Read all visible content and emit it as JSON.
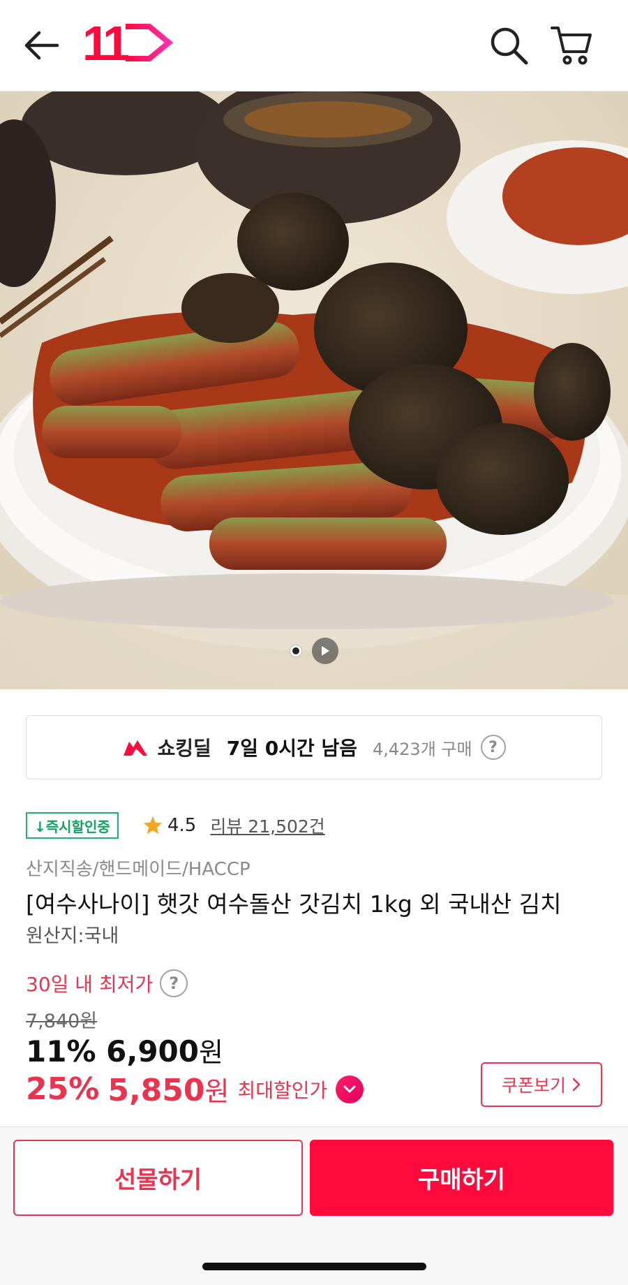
{
  "header": {
    "back_icon": "arrow-left-icon",
    "logo_text": "11",
    "search_icon": "search-icon",
    "cart_icon": "cart-icon"
  },
  "gallery": {
    "indicator_icons": [
      "page-dot-active",
      "play-video-icon"
    ]
  },
  "deal": {
    "title": "쇼킹딜",
    "time_left": "7일 0시간 남음",
    "purchase_count": "4,423개 구매",
    "help": "?"
  },
  "product": {
    "badge": "↓즉시할인중",
    "rating": "4.5",
    "review": "리뷰 21,502건",
    "tags": "산지직송/핸드메이드/HACCP",
    "title": "[여수사나이] 햇갓 여수돌산 갓김치 1kg 외 국내산 김치",
    "origin": "원산지:국내"
  },
  "price": {
    "lowest_label": "30일 내 최저가",
    "help": "?",
    "original": "7,840원",
    "discount1_rate": "11%",
    "discount1_price": "6,900",
    "discount2_rate": "25%",
    "discount2_price": "5,850",
    "won": "원",
    "max_label": "최대할인가",
    "coupon": "쿠폰보기"
  },
  "actions": {
    "gift": "선물하기",
    "buy": "구매하기"
  },
  "colors": {
    "accent": "#ff0a3c",
    "price_red": "#e9334f",
    "badge_green": "#12a25f"
  }
}
